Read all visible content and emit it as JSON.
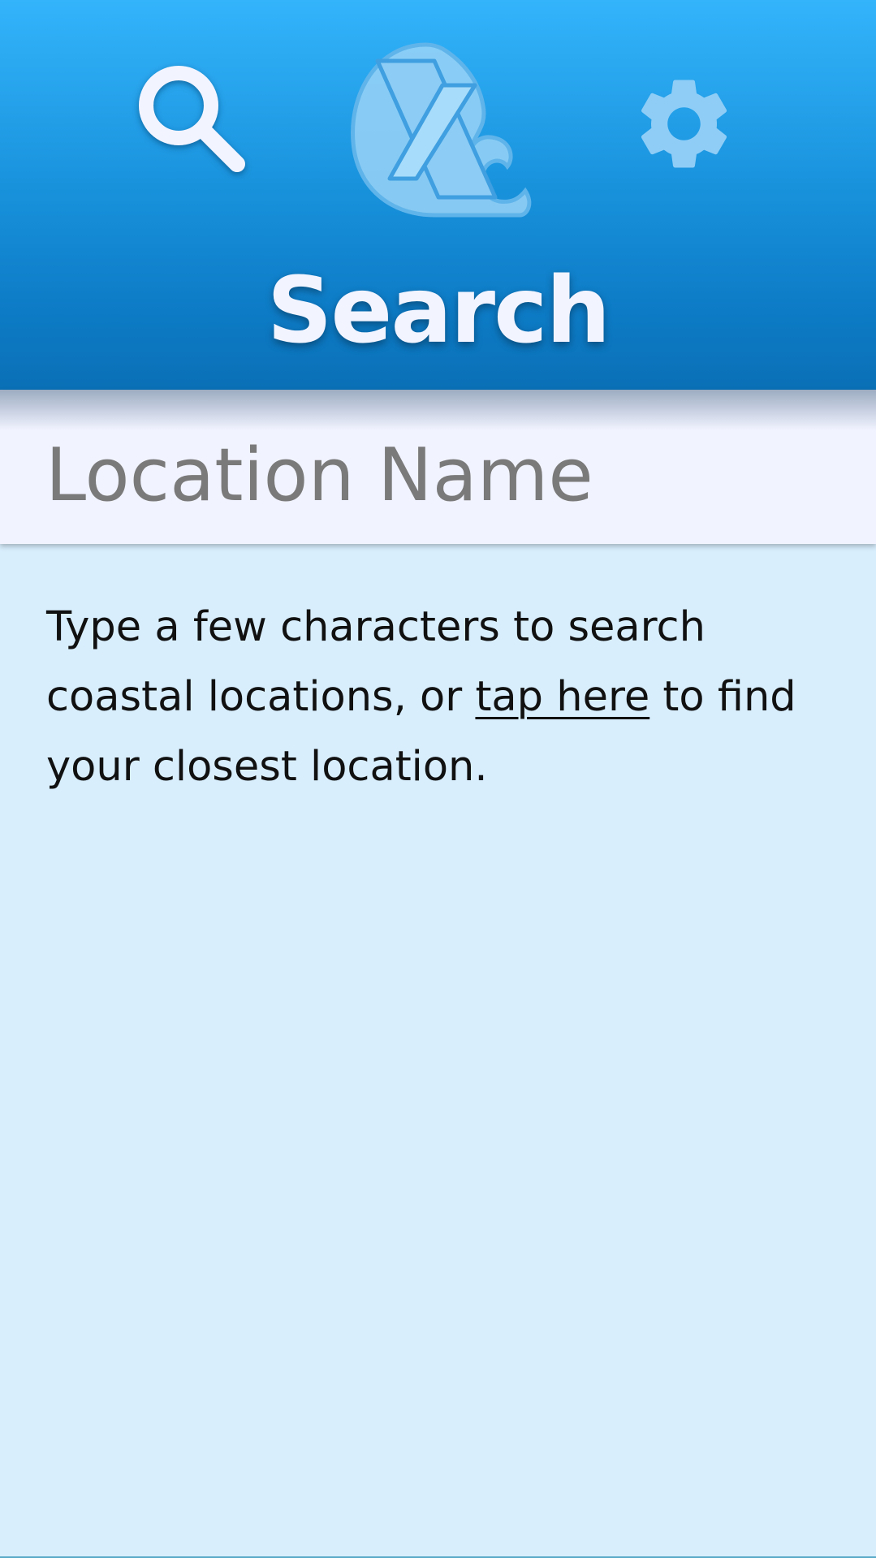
{
  "header": {
    "title": "Search",
    "search_icon": "search-icon",
    "settings_icon": "gear-icon",
    "logo": "wave-logo"
  },
  "search": {
    "placeholder": "Location Name",
    "value": ""
  },
  "help": {
    "text_before": "Type a few characters to search coastal locations, or ",
    "link_text": "tap here",
    "text_after": " to find your closest location."
  },
  "colors": {
    "header_top": "#33b4fb",
    "header_bottom": "#0a70b6",
    "background": "#d8eefd",
    "search_bar": "#f1f3ff",
    "title_text": "#f2f4ff",
    "settings_icon": "#8fcdf6"
  }
}
